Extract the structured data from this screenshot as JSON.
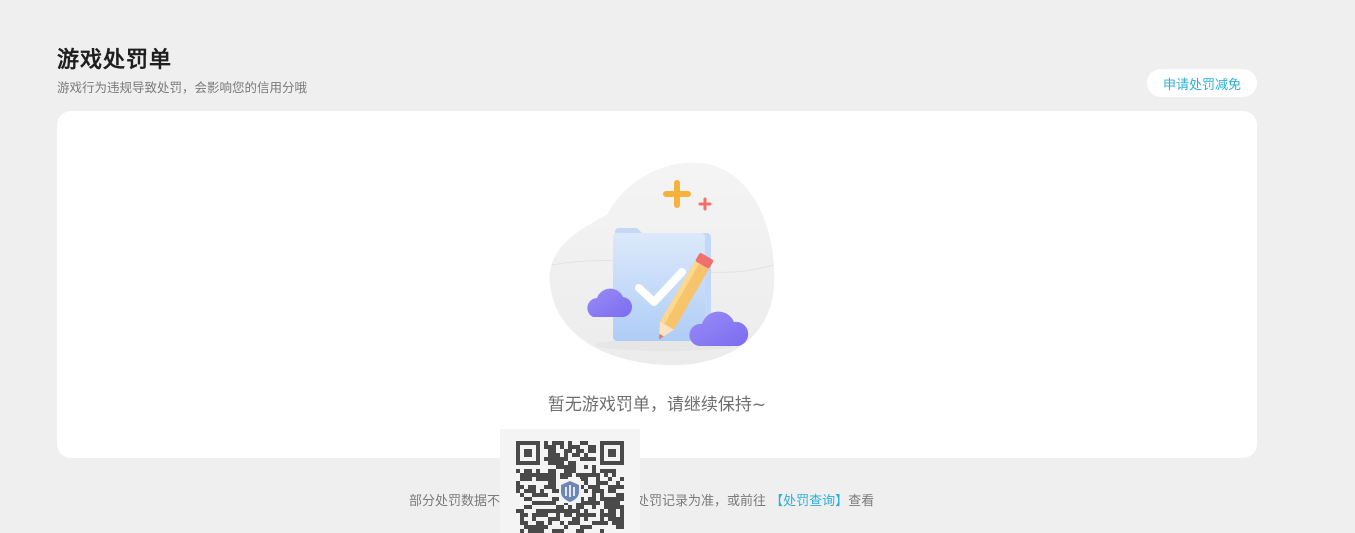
{
  "header": {
    "title": "游戏处罚单",
    "subtitle": "游戏行为违规导致处罚，会影响您的信用分哦",
    "appeal_button": "申请处罚减免"
  },
  "empty_state": {
    "message": "暂无游戏罚单，请继续保持~",
    "illustration_icon": "document-check-icon"
  },
  "footer": {
    "note_prefix": "部分处罚数据不支",
    "note_middle": "内处罚记录为准，或前往",
    "link_text": "【处罚查询】",
    "note_suffix": "查看",
    "qr_icon": "qr-code-icon",
    "shield_icon": "shield-icon"
  },
  "colors": {
    "accent": "#2daed8",
    "background": "#efefef",
    "card": "#ffffff"
  }
}
